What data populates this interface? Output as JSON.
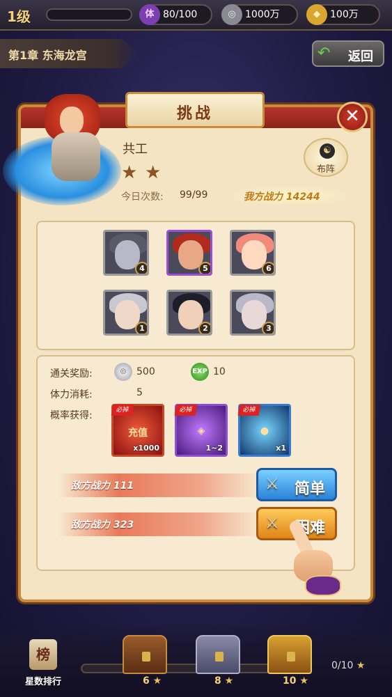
{
  "topbar": {
    "level": "1级",
    "stamina_icon": "体",
    "stamina": "80/100",
    "silver": "1000万",
    "gold": "100万"
  },
  "chapter": {
    "title": "第1章 东海龙宫",
    "back_label": "返回"
  },
  "dialog": {
    "title": "挑战",
    "close_icon": "close-icon",
    "boss_name": "共工",
    "stars": [
      "★",
      "★"
    ],
    "attempts_label": "今日次数:",
    "attempts_value": "99/99",
    "my_power": "我方战力 14244",
    "formation_label": "布阵",
    "formation_icon": "☯"
  },
  "enemies": [
    {
      "num": "4",
      "border": "gray",
      "hair": "#5a5a66",
      "face": "#b8b8c8"
    },
    {
      "num": "5",
      "border": "purple",
      "hair": "#b02a1e",
      "face": "#e8a888"
    },
    {
      "num": "6",
      "border": "gray",
      "hair": "#f08a7a",
      "face": "#ffd8c0"
    },
    {
      "num": "1",
      "border": "gray",
      "hair": "#c8c8d0",
      "face": "#f0d8c8"
    },
    {
      "num": "2",
      "border": "gray",
      "hair": "#1e1e2a",
      "face": "#f0d0b8"
    },
    {
      "num": "3",
      "border": "gray",
      "hair": "#b8b8c8",
      "face": "#e8d8d8"
    }
  ],
  "rewards": {
    "pass_label": "通关奖励:",
    "silver_amount": "500",
    "exp_label": "EXP",
    "exp_amount": "10",
    "cost_label": "体力消耗:",
    "cost_value": "5",
    "drop_label": "概率获得:",
    "items": [
      {
        "tag": "必掉",
        "name": "充值",
        "count": "x1000"
      },
      {
        "tag": "必掉",
        "name": "",
        "count": "1~2"
      },
      {
        "tag": "必掉",
        "name": "",
        "count": "x1"
      }
    ]
  },
  "difficulty": {
    "easy_power": "敌方战力 111",
    "easy_label": "简单",
    "hard_power": "敌方战力 323",
    "hard_label": "困难",
    "sword_icon": "⚔"
  },
  "bottom": {
    "rank_icon": "榜",
    "rank_label": "星数排行",
    "chest1": "6",
    "chest2": "8",
    "chest3": "10",
    "progress": "0/10",
    "star": "★"
  }
}
